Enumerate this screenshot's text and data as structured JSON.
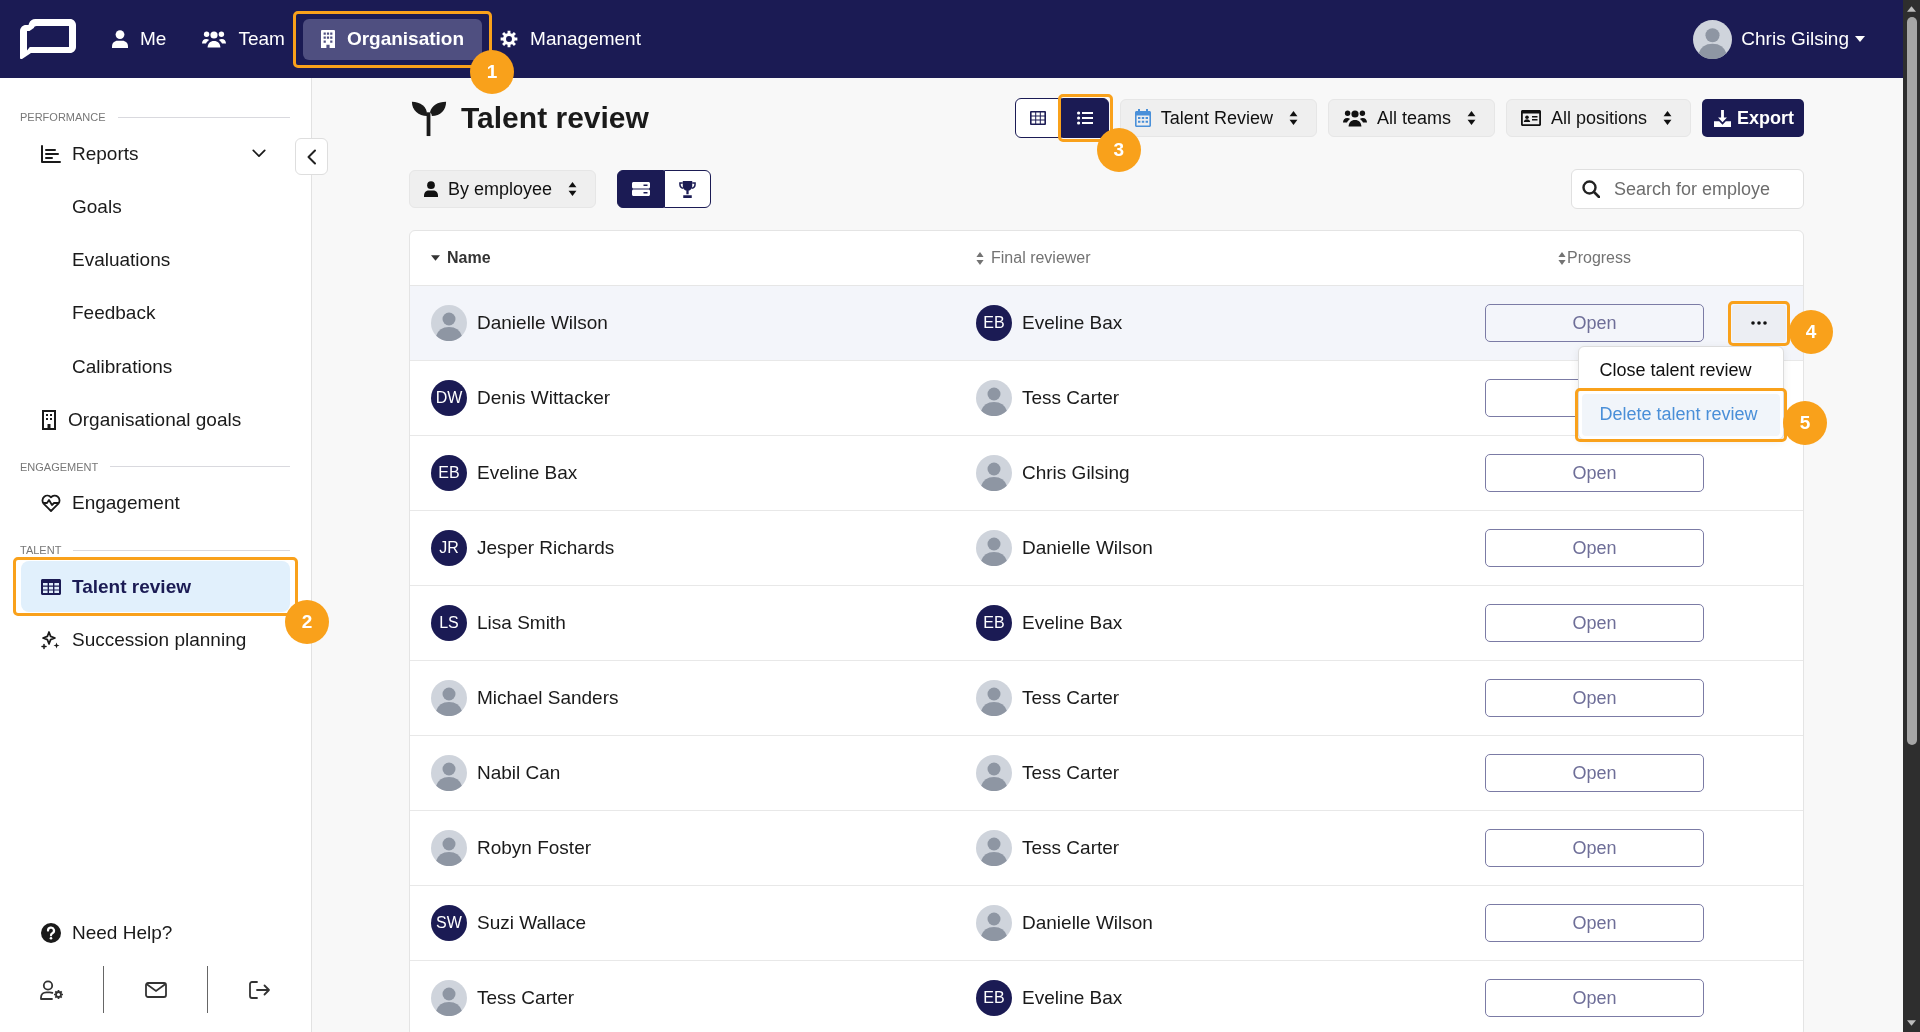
{
  "nav": {
    "items": [
      {
        "label": "Me",
        "selected": false
      },
      {
        "label": "Team",
        "selected": false
      },
      {
        "label": "Organisation",
        "selected": true,
        "callout": "1"
      },
      {
        "label": "Management",
        "selected": false
      }
    ],
    "user": {
      "name": "Chris Gilsing",
      "avatar": {
        "kind": "photo"
      }
    }
  },
  "sidebar": {
    "sections": [
      {
        "title": "PERFORMANCE",
        "items": [
          {
            "label": "Reports",
            "selected": false,
            "expanded": true,
            "children": [
              {
                "label": "Goals",
                "selected": false
              },
              {
                "label": "Evaluations",
                "selected": false
              },
              {
                "label": "Feedback",
                "selected": false
              },
              {
                "label": "Calibrations",
                "selected": false
              }
            ]
          },
          {
            "label": "Organisational goals",
            "selected": false
          }
        ]
      },
      {
        "title": "ENGAGEMENT",
        "items": [
          {
            "label": "Engagement",
            "selected": false
          }
        ]
      },
      {
        "title": "TALENT",
        "items": [
          {
            "label": "Talent review",
            "selected": true,
            "callout": "2"
          },
          {
            "label": "Succession planning",
            "selected": false
          }
        ]
      }
    ],
    "help": {
      "label": "Need Help?"
    }
  },
  "page": {
    "title": "Talent review",
    "view_toggle": [
      {
        "selected": false
      },
      {
        "selected": true,
        "callout": "3"
      }
    ],
    "filters": [
      {
        "label": "Talent Review"
      },
      {
        "label": "All teams"
      },
      {
        "label": "All positions"
      }
    ],
    "export_button": {
      "label": "Export"
    },
    "group_by": {
      "label": "By employee"
    },
    "mode_toggle": [
      {
        "selected": true
      },
      {
        "selected": false
      }
    ],
    "search": {
      "placeholder": "Search for employe"
    }
  },
  "table": {
    "columns": [
      {
        "label": "Name",
        "sorted": true
      },
      {
        "label": "Final reviewer",
        "sorted": false
      },
      {
        "label": "Progress",
        "sorted": false
      }
    ],
    "rows": [
      {
        "employee": {
          "name": "Danielle Wilson",
          "avatar": {
            "kind": "photo"
          }
        },
        "reviewer": {
          "name": "Eveline Bax",
          "avatar": {
            "kind": "initials",
            "text": "EB"
          }
        },
        "progress": "Open",
        "highlighted": true,
        "actions": {
          "callout": "4",
          "menu": {
            "items": [
              {
                "label": "Close talent review",
                "highlighted": false
              },
              {
                "label": "Delete talent review",
                "highlighted": true,
                "callout": "5"
              }
            ]
          }
        }
      },
      {
        "employee": {
          "name": "Denis Wittacker",
          "avatar": {
            "kind": "initials",
            "text": "DW"
          }
        },
        "reviewer": {
          "name": "Tess Carter",
          "avatar": {
            "kind": "photo"
          }
        },
        "highlighted": false
      },
      {
        "employee": {
          "name": "Eveline Bax",
          "avatar": {
            "kind": "initials",
            "text": "EB"
          }
        },
        "reviewer": {
          "name": "Chris Gilsing",
          "avatar": {
            "kind": "photo"
          }
        },
        "progress": "Open",
        "highlighted": false
      },
      {
        "employee": {
          "name": "Jesper Richards",
          "avatar": {
            "kind": "initials",
            "text": "JR"
          }
        },
        "reviewer": {
          "name": "Danielle Wilson",
          "avatar": {
            "kind": "photo"
          }
        },
        "progress": "Open",
        "highlighted": false
      },
      {
        "employee": {
          "name": "Lisa Smith",
          "avatar": {
            "kind": "initials",
            "text": "LS"
          }
        },
        "reviewer": {
          "name": "Eveline Bax",
          "avatar": {
            "kind": "initials",
            "text": "EB"
          }
        },
        "progress": "Open",
        "highlighted": false
      },
      {
        "employee": {
          "name": "Michael Sanders",
          "avatar": {
            "kind": "photo"
          }
        },
        "reviewer": {
          "name": "Tess Carter",
          "avatar": {
            "kind": "photo"
          }
        },
        "progress": "Open",
        "highlighted": false
      },
      {
        "employee": {
          "name": "Nabil Can",
          "avatar": {
            "kind": "photo"
          }
        },
        "reviewer": {
          "name": "Tess Carter",
          "avatar": {
            "kind": "photo"
          }
        },
        "progress": "Open",
        "highlighted": false
      },
      {
        "employee": {
          "name": "Robyn Foster",
          "avatar": {
            "kind": "photo"
          }
        },
        "reviewer": {
          "name": "Tess Carter",
          "avatar": {
            "kind": "photo"
          }
        },
        "progress": "Open",
        "highlighted": false
      },
      {
        "employee": {
          "name": "Suzi Wallace",
          "avatar": {
            "kind": "initials",
            "text": "SW"
          }
        },
        "reviewer": {
          "name": "Danielle Wilson",
          "avatar": {
            "kind": "photo"
          }
        },
        "progress": "Open",
        "highlighted": false
      },
      {
        "employee": {
          "name": "Tess Carter",
          "avatar": {
            "kind": "photo"
          }
        },
        "reviewer": {
          "name": "Eveline Bax",
          "avatar": {
            "kind": "initials",
            "text": "EB"
          }
        },
        "progress": "Open",
        "highlighted": false
      }
    ]
  }
}
